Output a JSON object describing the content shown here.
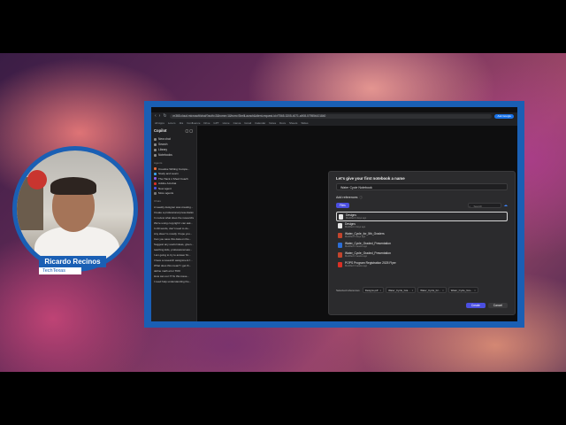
{
  "browser": {
    "url": "m365.cloud.microsoft/chat/?auth=2&home=1&from=ShellLaunch&client-request-id=f7565-3205-4071-a908-07955b101840",
    "profile_pill": "Ask Google",
    "bookmarks": [
      "All Apps",
      "Lorem",
      "Jira",
      "Confluence",
      "Drive",
      "GPT",
      "Home",
      "Canva",
      "Gmail",
      "Calendar",
      "Notes",
      "Docs",
      "Sheets",
      "Slides"
    ]
  },
  "sidebar": {
    "title": "Copilot",
    "nav": [
      {
        "label": "New chat"
      },
      {
        "label": "Search"
      },
      {
        "label": "Library"
      },
      {
        "label": "Notebooks"
      }
    ],
    "agents_header": "Agents",
    "agents": [
      {
        "label": "Creative Writing Compa...",
        "color": "#e86a3a"
      },
      {
        "label": "Study and Learn",
        "color": "#3aa0e8"
      },
      {
        "label": "The Hack n Shed Coach",
        "color": "#8a5ae8"
      },
      {
        "label": "Adobe Acrobat",
        "color": "#d93025"
      },
      {
        "label": "New agent",
        "color": "#4b4fe0"
      },
      {
        "label": "More agents",
        "color": "#777777"
      }
    ],
    "chats_header": "Chats",
    "chats": [
      "A weekly designer was creating...",
      "Create a professional presentation...",
      "In review what does the researcher...",
      "We're using copyright I can ask...",
      "In 60 words, don't need to do...",
      "Any idea I'm mostly I hope you...",
      "Can you save this data on the...",
      "Suggest any useful ideas, given...",
      "teaching kids, professional ass...",
      "I am going to try to answer fin...",
      "I have a research assignment f...",
      "What does this mean? i get th...",
      "define math error TRO",
      "How can our IT fix this issue...",
      "I need help understanding the..."
    ]
  },
  "modal": {
    "title": "Let's give your first notebook a name",
    "name_value": "Water Cycle Notebook",
    "add_references_label": "Add references",
    "files_tab": "Files",
    "search_placeholder": "Search",
    "files": [
      {
        "name": "Designs",
        "meta": "Modified 3 days ago",
        "type": "doc",
        "selected": true
      },
      {
        "name": "Designs",
        "meta": "Modified 4 days ago",
        "type": "doc",
        "selected": false
      },
      {
        "name": "Water_Cycle_for_5th_Graders",
        "meta": "Modified 5 days ago",
        "type": "ppt",
        "selected": false
      },
      {
        "name": "Water_Cycle_Graded_Presentation",
        "meta": "Modified 2 weeks ago",
        "type": "word",
        "selected": false
      },
      {
        "name": "Water_Cycle_Graded_Presentation",
        "meta": "Modified 2 weeks ago",
        "type": "ppt",
        "selected": false
      },
      {
        "name": "POPS Program Registration 2025 Flyer",
        "meta": "Modified 3 weeks ago",
        "type": "pdf",
        "selected": false
      }
    ],
    "selected_references_label": "Selected references",
    "selected_chips": [
      "Designs.pdf",
      "Water_Cycle_Gra...",
      "Water_Cycle_for...",
      "Water_Cycle_Gra..."
    ],
    "create_label": "Create",
    "cancel_label": "Cancel"
  },
  "presenter": {
    "name": "Ricardo Recinos",
    "subtitle": "TechTexas"
  }
}
